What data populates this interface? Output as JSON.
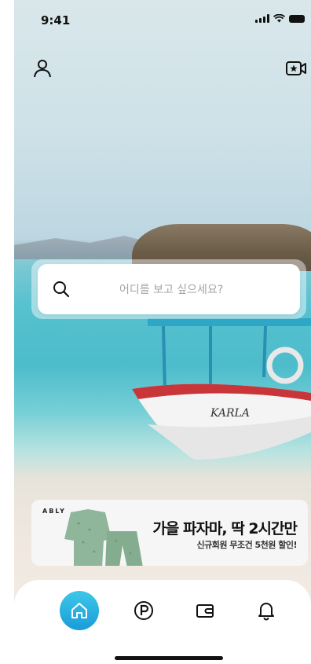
{
  "status_bar": {
    "time": "9:41"
  },
  "header": {
    "profile_icon": "person-icon",
    "right_icon": "video-star-icon"
  },
  "search": {
    "placeholder": "어디를 보고 싶으세요?"
  },
  "banner": {
    "brand": "ABLY",
    "title": "가을 파자마, 딱 2시간만",
    "subtitle": "신규회원 무조건 5천원 할인!"
  },
  "tab_bar": {
    "items": [
      {
        "icon": "home-icon",
        "active": true
      },
      {
        "icon": "parking-icon",
        "active": false
      },
      {
        "icon": "wallet-icon",
        "active": false
      },
      {
        "icon": "bell-icon",
        "active": false
      }
    ]
  },
  "colors": {
    "accent": "#1fb1e0",
    "text": "#111111",
    "placeholder": "#a0a4aa"
  }
}
